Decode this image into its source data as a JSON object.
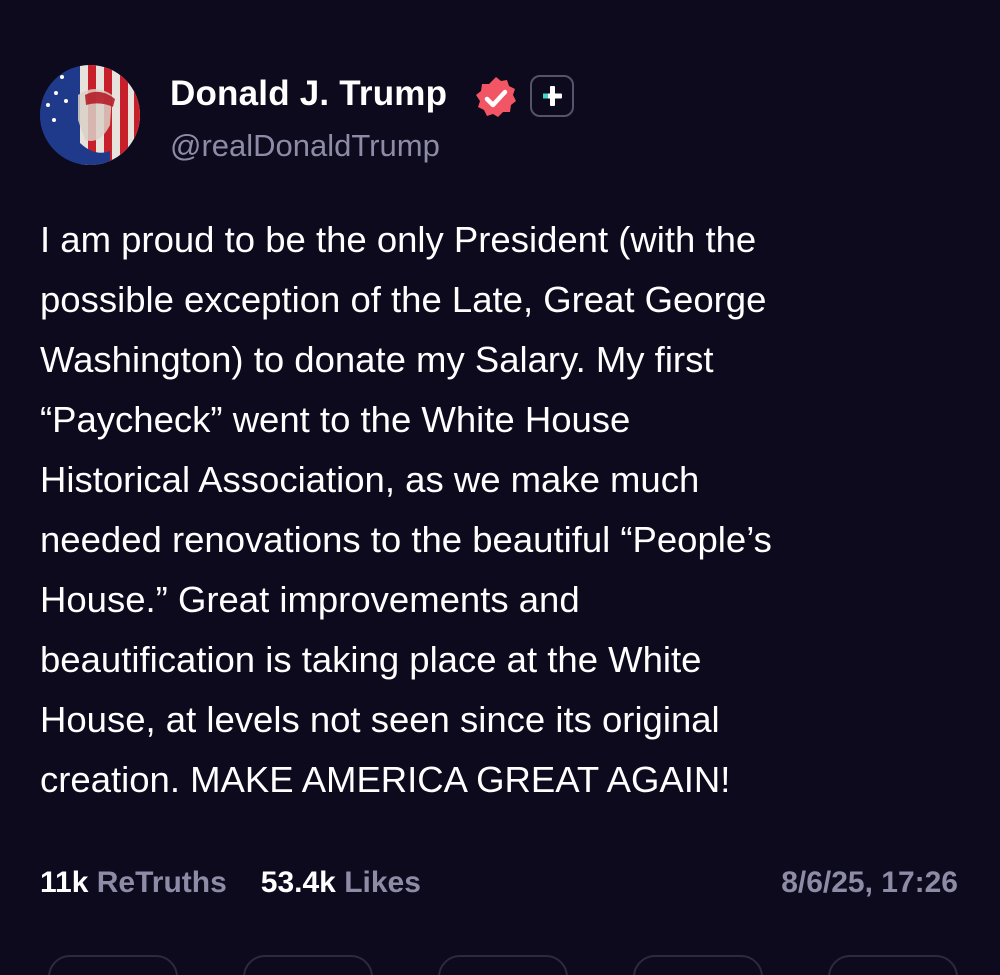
{
  "post": {
    "author": {
      "display_name": "Donald J. Trump",
      "handle": "@realDonaldTrump",
      "verified_icon": "verified-badge-icon",
      "follow_icon": "plus-icon"
    },
    "body_lines": [
      "I am proud to be the only President (with the",
      "possible exception of the Late, Great George",
      "Washington) to donate my Salary. My first",
      "“Paycheck” went to the White House",
      "Historical Association, as we make much",
      "needed renovations to the beautiful “People’s",
      "House.” Great improvements and",
      "beautification is taking place at the White",
      "House, at levels not seen since its original",
      "creation. MAKE AMERICA GREAT AGAIN!"
    ],
    "stats": {
      "retruths_count": "11k",
      "retruths_label": "ReTruths",
      "likes_count": "53.4k",
      "likes_label": "Likes"
    },
    "timestamp": "8/6/25, 17:26"
  },
  "colors": {
    "background": "#0c0a1c",
    "muted_text": "#8e8ba6",
    "verified_badge": "#f25563"
  }
}
